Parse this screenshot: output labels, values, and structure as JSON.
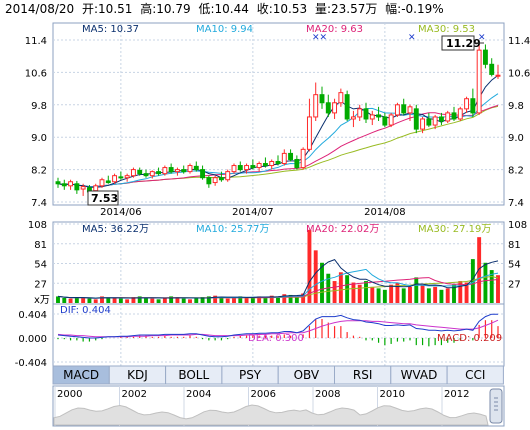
{
  "header": {
    "date": "2014/08/20",
    "open_label": "开:",
    "open": "10.51",
    "high_label": "高:",
    "high": "10.79",
    "low_label": "低:",
    "low": "10.44",
    "close_label": "收:",
    "close": "10.53",
    "volume_label": "量:",
    "volume": "23.57万",
    "change_label": "幅:",
    "change": "-0.19%"
  },
  "colors": {
    "up": "#ff2a2a",
    "down": "#00aa00",
    "ma5": "#0a2f6e",
    "ma10": "#22aadd",
    "ma20": "#dd2277",
    "ma30": "#99bb22",
    "dif": "#1e3dcc",
    "dea": "#cc33cc",
    "grid": "#c8d4e4",
    "frame": "#8ca0c0",
    "tab_bg": "#e6ecf6",
    "tab_active": "#a8bedd"
  },
  "price_panel": {
    "ma_labels": {
      "ma5": "MA5: 10.37",
      "ma10": "MA10: 9.94",
      "ma20": "MA20: 9.63",
      "ma30": "MA30: 9.53"
    },
    "y_ticks": [
      "11.4",
      "10.6",
      "9.8",
      "9.0",
      "8.2",
      "7.4"
    ],
    "x_ticks": [
      "2014/06",
      "2014/07",
      "2014/08"
    ],
    "max_annotation": "11.29",
    "min_annotation": "7.53"
  },
  "volume_panel": {
    "ma_labels": {
      "ma5": "MA5: 36.22万",
      "ma10": "MA10: 25.77万",
      "ma20": "MA20: 22.02万",
      "ma30": "MA30: 27.19万"
    },
    "y_ticks": [
      "108",
      "81",
      "54",
      "27"
    ],
    "unit": "x万"
  },
  "macd_panel": {
    "dif_label": "DIF: 0.404",
    "dea_label": "DEA: 0.300",
    "macd_label": "MACD: 0.209",
    "y_ticks": [
      "0.404",
      "0.000",
      "-0.404"
    ]
  },
  "tabs": [
    "MACD",
    "KDJ",
    "BOLL",
    "PSY",
    "OBV",
    "RSI",
    "WVAD",
    "CCI"
  ],
  "active_tab": "MACD",
  "overview": {
    "years": [
      "2000",
      "2002",
      "2004",
      "2006",
      "2008",
      "2010",
      "2012"
    ]
  },
  "chart_data": [
    {
      "type": "candlestick",
      "ylim": [
        7.4,
        11.4
      ],
      "x_ticks": [
        "2014/06",
        "2014/07",
        "2014/08"
      ],
      "candles": [
        {
          "o": 7.9,
          "h": 8.0,
          "l": 7.75,
          "c": 7.85
        },
        {
          "o": 7.85,
          "h": 7.95,
          "l": 7.7,
          "c": 7.8
        },
        {
          "o": 7.8,
          "h": 7.95,
          "l": 7.7,
          "c": 7.9
        },
        {
          "o": 7.85,
          "h": 7.92,
          "l": 7.6,
          "c": 7.7
        },
        {
          "o": 7.72,
          "h": 7.85,
          "l": 7.55,
          "c": 7.78
        },
        {
          "o": 7.75,
          "h": 7.82,
          "l": 7.53,
          "c": 7.65
        },
        {
          "o": 7.68,
          "h": 7.85,
          "l": 7.62,
          "c": 7.8
        },
        {
          "o": 7.8,
          "h": 8.0,
          "l": 7.75,
          "c": 7.95
        },
        {
          "o": 7.92,
          "h": 8.05,
          "l": 7.85,
          "c": 7.88
        },
        {
          "o": 7.9,
          "h": 8.1,
          "l": 7.85,
          "c": 8.05
        },
        {
          "o": 8.02,
          "h": 8.15,
          "l": 7.95,
          "c": 8.0
        },
        {
          "o": 8.0,
          "h": 8.1,
          "l": 7.9,
          "c": 8.05
        },
        {
          "o": 8.05,
          "h": 8.25,
          "l": 8.0,
          "c": 8.2
        },
        {
          "o": 8.18,
          "h": 8.25,
          "l": 8.05,
          "c": 8.1
        },
        {
          "o": 8.1,
          "h": 8.2,
          "l": 8.0,
          "c": 8.05
        },
        {
          "o": 8.05,
          "h": 8.18,
          "l": 7.98,
          "c": 8.15
        },
        {
          "o": 8.15,
          "h": 8.25,
          "l": 8.05,
          "c": 8.1
        },
        {
          "o": 8.1,
          "h": 8.3,
          "l": 8.05,
          "c": 8.25
        },
        {
          "o": 8.25,
          "h": 8.35,
          "l": 8.1,
          "c": 8.15
        },
        {
          "o": 8.15,
          "h": 8.25,
          "l": 8.05,
          "c": 8.2
        },
        {
          "o": 8.2,
          "h": 8.3,
          "l": 8.1,
          "c": 8.15
        },
        {
          "o": 8.15,
          "h": 8.35,
          "l": 8.1,
          "c": 8.3
        },
        {
          "o": 8.28,
          "h": 8.4,
          "l": 8.15,
          "c": 8.2
        },
        {
          "o": 8.2,
          "h": 8.3,
          "l": 7.95,
          "c": 8.0
        },
        {
          "o": 8.0,
          "h": 8.05,
          "l": 7.75,
          "c": 7.85
        },
        {
          "o": 7.88,
          "h": 8.05,
          "l": 7.8,
          "c": 8.0
        },
        {
          "o": 8.0,
          "h": 8.15,
          "l": 7.9,
          "c": 7.95
        },
        {
          "o": 7.95,
          "h": 8.2,
          "l": 7.9,
          "c": 8.15
        },
        {
          "o": 8.15,
          "h": 8.35,
          "l": 8.1,
          "c": 8.3
        },
        {
          "o": 8.3,
          "h": 8.4,
          "l": 8.15,
          "c": 8.2
        },
        {
          "o": 8.2,
          "h": 8.35,
          "l": 8.1,
          "c": 8.3
        },
        {
          "o": 8.3,
          "h": 8.45,
          "l": 8.2,
          "c": 8.25
        },
        {
          "o": 8.25,
          "h": 8.4,
          "l": 8.15,
          "c": 8.35
        },
        {
          "o": 8.35,
          "h": 8.5,
          "l": 8.25,
          "c": 8.3
        },
        {
          "o": 8.3,
          "h": 8.45,
          "l": 8.2,
          "c": 8.4
        },
        {
          "o": 8.4,
          "h": 8.55,
          "l": 8.3,
          "c": 8.35
        },
        {
          "o": 8.35,
          "h": 8.7,
          "l": 8.3,
          "c": 8.6
        },
        {
          "o": 8.6,
          "h": 8.7,
          "l": 8.4,
          "c": 8.45
        },
        {
          "o": 8.45,
          "h": 8.55,
          "l": 8.2,
          "c": 8.25
        },
        {
          "o": 8.25,
          "h": 8.75,
          "l": 8.2,
          "c": 8.7
        },
        {
          "o": 8.7,
          "h": 9.95,
          "l": 8.65,
          "c": 9.5
        },
        {
          "o": 9.5,
          "h": 10.35,
          "l": 9.4,
          "c": 10.05
        },
        {
          "o": 10.05,
          "h": 10.25,
          "l": 9.7,
          "c": 9.85
        },
        {
          "o": 9.85,
          "h": 10.05,
          "l": 9.5,
          "c": 9.6
        },
        {
          "o": 9.6,
          "h": 9.95,
          "l": 9.45,
          "c": 9.85
        },
        {
          "o": 9.85,
          "h": 10.2,
          "l": 9.75,
          "c": 10.1
        },
        {
          "o": 10.05,
          "h": 10.15,
          "l": 9.4,
          "c": 9.45
        },
        {
          "o": 9.45,
          "h": 9.65,
          "l": 9.25,
          "c": 9.5
        },
        {
          "o": 9.5,
          "h": 9.8,
          "l": 9.4,
          "c": 9.7
        },
        {
          "o": 9.7,
          "h": 9.85,
          "l": 9.35,
          "c": 9.45
        },
        {
          "o": 9.45,
          "h": 9.65,
          "l": 9.3,
          "c": 9.55
        },
        {
          "o": 9.55,
          "h": 9.75,
          "l": 9.4,
          "c": 9.5
        },
        {
          "o": 9.5,
          "h": 9.6,
          "l": 9.25,
          "c": 9.3
        },
        {
          "o": 9.3,
          "h": 9.6,
          "l": 9.25,
          "c": 9.55
        },
        {
          "o": 9.55,
          "h": 9.85,
          "l": 9.5,
          "c": 9.8
        },
        {
          "o": 9.8,
          "h": 9.95,
          "l": 9.55,
          "c": 9.6
        },
        {
          "o": 9.6,
          "h": 9.8,
          "l": 9.4,
          "c": 9.75
        },
        {
          "o": 9.7,
          "h": 9.8,
          "l": 9.1,
          "c": 9.2
        },
        {
          "o": 9.2,
          "h": 9.5,
          "l": 9.1,
          "c": 9.45
        },
        {
          "o": 9.45,
          "h": 9.6,
          "l": 9.25,
          "c": 9.3
        },
        {
          "o": 9.3,
          "h": 9.55,
          "l": 9.2,
          "c": 9.5
        },
        {
          "o": 9.5,
          "h": 9.6,
          "l": 9.3,
          "c": 9.4
        },
        {
          "o": 9.4,
          "h": 9.65,
          "l": 9.35,
          "c": 9.6
        },
        {
          "o": 9.6,
          "h": 9.75,
          "l": 9.4,
          "c": 9.45
        },
        {
          "o": 9.45,
          "h": 9.75,
          "l": 9.4,
          "c": 9.7
        },
        {
          "o": 9.7,
          "h": 10.0,
          "l": 9.6,
          "c": 9.95
        },
        {
          "o": 9.95,
          "h": 10.2,
          "l": 9.5,
          "c": 9.6
        },
        {
          "o": 9.6,
          "h": 11.29,
          "l": 9.55,
          "c": 11.15
        },
        {
          "o": 11.15,
          "h": 11.29,
          "l": 10.7,
          "c": 10.8
        },
        {
          "o": 10.8,
          "h": 10.95,
          "l": 10.5,
          "c": 10.55
        },
        {
          "o": 10.51,
          "h": 10.79,
          "l": 10.44,
          "c": 10.53
        }
      ]
    },
    {
      "type": "bar",
      "name": "volume",
      "ylim": [
        0,
        108
      ],
      "values": [
        9,
        7,
        6,
        8,
        7,
        6,
        5,
        9,
        8,
        7,
        6,
        5,
        8,
        9,
        7,
        6,
        5,
        7,
        9,
        8,
        6,
        5,
        7,
        8,
        9,
        10,
        7,
        6,
        8,
        9,
        8,
        7,
        9,
        8,
        10,
        9,
        12,
        11,
        9,
        13,
        100,
        72,
        55,
        40,
        30,
        42,
        38,
        28,
        25,
        30,
        22,
        20,
        18,
        25,
        28,
        20,
        22,
        35,
        24,
        20,
        22,
        18,
        20,
        25,
        30,
        28,
        60,
        90,
        55,
        45,
        38
      ],
      "directions": [
        "d",
        "d",
        "u",
        "d",
        "u",
        "d",
        "u",
        "u",
        "d",
        "u",
        "d",
        "u",
        "u",
        "d",
        "d",
        "u",
        "d",
        "u",
        "d",
        "u",
        "d",
        "u",
        "d",
        "d",
        "d",
        "u",
        "d",
        "u",
        "u",
        "d",
        "u",
        "d",
        "u",
        "d",
        "u",
        "d",
        "u",
        "d",
        "d",
        "u",
        "u",
        "u",
        "d",
        "d",
        "u",
        "u",
        "d",
        "u",
        "u",
        "d",
        "u",
        "d",
        "d",
        "u",
        "u",
        "d",
        "u",
        "d",
        "u",
        "d",
        "u",
        "d",
        "u",
        "d",
        "u",
        "u",
        "d",
        "u",
        "d",
        "d",
        "u"
      ]
    },
    {
      "type": "line",
      "name": "macd",
      "ylim": [
        -0.404,
        0.404
      ],
      "dif": [
        0.05,
        0.04,
        0.03,
        0.02,
        0.01,
        0.0,
        0.0,
        0.01,
        0.02,
        0.02,
        0.03,
        0.03,
        0.04,
        0.05,
        0.05,
        0.05,
        0.05,
        0.06,
        0.06,
        0.06,
        0.06,
        0.07,
        0.07,
        0.05,
        0.03,
        0.02,
        0.02,
        0.03,
        0.05,
        0.06,
        0.07,
        0.07,
        0.08,
        0.08,
        0.09,
        0.09,
        0.11,
        0.11,
        0.09,
        0.12,
        0.22,
        0.32,
        0.36,
        0.36,
        0.36,
        0.38,
        0.34,
        0.31,
        0.3,
        0.27,
        0.26,
        0.24,
        0.21,
        0.21,
        0.22,
        0.21,
        0.22,
        0.16,
        0.15,
        0.13,
        0.13,
        0.12,
        0.13,
        0.12,
        0.13,
        0.15,
        0.13,
        0.28,
        0.36,
        0.4,
        0.4
      ],
      "dea": [
        0.06,
        0.05,
        0.05,
        0.04,
        0.04,
        0.03,
        0.02,
        0.02,
        0.02,
        0.02,
        0.02,
        0.02,
        0.03,
        0.03,
        0.03,
        0.04,
        0.04,
        0.04,
        0.05,
        0.05,
        0.05,
        0.05,
        0.06,
        0.06,
        0.05,
        0.04,
        0.04,
        0.04,
        0.04,
        0.04,
        0.05,
        0.05,
        0.06,
        0.06,
        0.07,
        0.07,
        0.08,
        0.09,
        0.09,
        0.09,
        0.12,
        0.16,
        0.2,
        0.23,
        0.26,
        0.28,
        0.29,
        0.29,
        0.29,
        0.29,
        0.28,
        0.28,
        0.27,
        0.26,
        0.25,
        0.24,
        0.24,
        0.22,
        0.21,
        0.2,
        0.19,
        0.18,
        0.17,
        0.16,
        0.15,
        0.15,
        0.15,
        0.17,
        0.21,
        0.25,
        0.3
      ]
    }
  ]
}
